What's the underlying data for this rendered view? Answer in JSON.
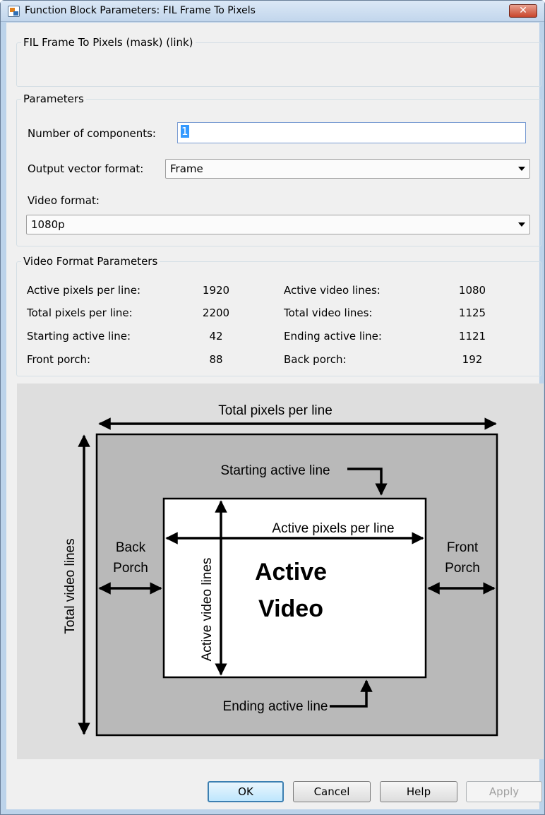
{
  "window": {
    "title": "Function Block Parameters: FIL Frame To Pixels",
    "close_icon": "close-icon",
    "app_icon": "simulink-block-icon"
  },
  "mask": {
    "legend": "FIL Frame To Pixels (mask) (link)"
  },
  "parameters": {
    "legend": "Parameters",
    "num_components_label": "Number of components:",
    "num_components_value": "1",
    "output_vector_label": "Output vector format:",
    "output_vector_value": "Frame",
    "video_format_label": "Video format:",
    "video_format_value": "1080p"
  },
  "video_format_parameters": {
    "legend": "Video Format Parameters",
    "left": [
      {
        "label": "Active pixels per line:",
        "value": "1920"
      },
      {
        "label": "Total pixels per line:",
        "value": "2200"
      },
      {
        "label": "Starting active line:",
        "value": "42"
      },
      {
        "label": "Front porch:",
        "value": "88"
      }
    ],
    "right": [
      {
        "label": "Active video lines:",
        "value": "1080"
      },
      {
        "label": "Total video lines:",
        "value": "1125"
      },
      {
        "label": "Ending active line:",
        "value": "1121"
      },
      {
        "label": "Back porch:",
        "value": "192"
      }
    ]
  },
  "diagram": {
    "total_pixels_per_line": "Total pixels per line",
    "total_video_lines": "Total video lines",
    "starting_active_line": "Starting active line",
    "ending_active_line": "Ending active line",
    "active_pixels_per_line": "Active pixels per line",
    "active_video_lines": "Active video lines",
    "back_porch_1": "Back",
    "back_porch_2": "Porch",
    "front_porch_1": "Front",
    "front_porch_2": "Porch",
    "active_video_1": "Active",
    "active_video_2": "Video",
    "colors": {
      "frame_fill": "#b9b9b9",
      "active_fill": "#ffffff",
      "background": "#dedede"
    }
  },
  "buttons": {
    "ok": "OK",
    "cancel": "Cancel",
    "help": "Help",
    "apply": "Apply"
  }
}
